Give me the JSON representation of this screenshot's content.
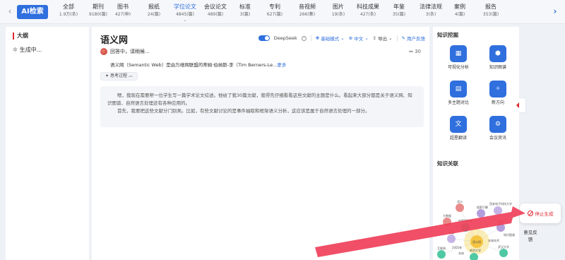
{
  "topbar": {
    "brand": "AI检索",
    "categories": [
      {
        "name": "全部",
        "count": "1.9万(条)"
      },
      {
        "name": "期刊",
        "count": "9180(篇)"
      },
      {
        "name": "图书",
        "count": "427(种)"
      },
      {
        "name": "报纸",
        "count": "24(篇)"
      },
      {
        "name": "学位论文",
        "count": "4845(篇)",
        "active": true
      },
      {
        "name": "会议论文",
        "count": "489(篇)"
      },
      {
        "name": "标准",
        "count": "3(篇)"
      },
      {
        "name": "专利",
        "count": "627(篇)"
      },
      {
        "name": "音视频",
        "count": "266(集)"
      },
      {
        "name": "图片",
        "count": "19(条)"
      },
      {
        "name": "科技成果",
        "count": "427(条)"
      },
      {
        "name": "年鉴",
        "count": "35(篇)"
      },
      {
        "name": "法律法规",
        "count": "3(条)"
      },
      {
        "name": "案例",
        "count": "4(篇)"
      },
      {
        "name": "报告",
        "count": "353(篇)"
      }
    ]
  },
  "outline": {
    "title": "大纲",
    "generating": "生成中..."
  },
  "main": {
    "title": "语义网",
    "toolbar": {
      "deepseek": "DeepSeek",
      "mode": "基础模式",
      "language": "中文",
      "export": "导出",
      "feedback": "用户反馈"
    },
    "status": "回答中，请稍候...",
    "ref_count": "30",
    "intro": "语义网（Semantic Web）是由万维网联盟的蒂姆·伯纳斯-李（Tim Berners-Le...",
    "more": "更多",
    "think_label": "思考过程",
    "think_p1": "嗯，我现在需要帮一位学生写一篇学术论文综述。他给了我30篇文献，我得先仔细看看这些文献的主题是什么。看起来大部分都是关于语义网、知识图谱、自然语言处理还有各种应用的。",
    "think_p2": "首先，我要把这些文献分门别类。比如，有些文献讨论的是事件抽取和框架语义分析，这应该是属于自然语言处理的一部分。"
  },
  "knowledge": {
    "title": "知识挖掘",
    "items": [
      {
        "label": "可视化分析",
        "icon": "chart-icon"
      },
      {
        "label": "知识图谱",
        "icon": "graph-icon"
      },
      {
        "label": "多主题对比",
        "icon": "compare-icon"
      },
      {
        "label": "新方向",
        "icon": "compass-icon"
      },
      {
        "label": "超星翻译",
        "icon": "translate-icon"
      },
      {
        "label": "会议资讯",
        "icon": "gear-icon"
      }
    ],
    "relation_title": "知识关联",
    "graph_nodes": [
      "语义",
      "搜索引擎",
      "西安电子科技大学",
      "大数据",
      "中国科学院",
      "本体",
      "本题",
      "知识图谱",
      "互联网",
      "语义网",
      "南京大学",
      "武汉大学",
      "本体技术",
      "2005年",
      "本体"
    ]
  },
  "controls": {
    "stop": "停止生成",
    "feedback": "意见反馈"
  },
  "colors": {
    "accent": "#2f6fde",
    "danger": "#e0272f",
    "arrow": "#f0405a"
  }
}
